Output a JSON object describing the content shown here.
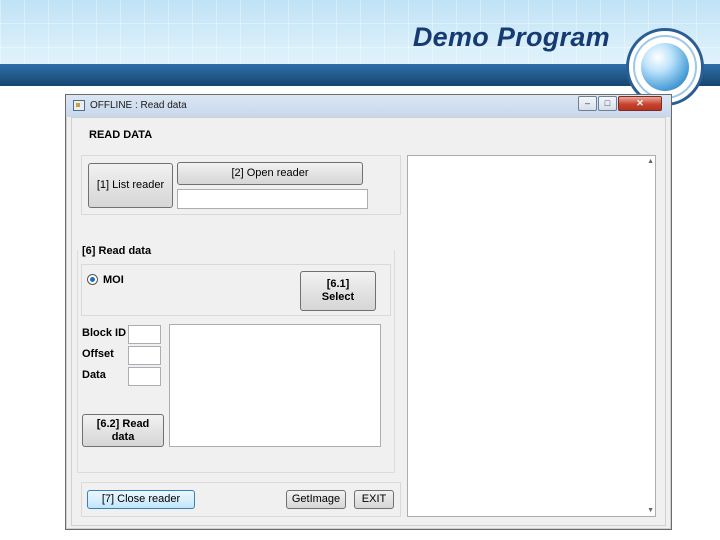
{
  "slide": {
    "title": "Demo Program"
  },
  "window": {
    "title": "OFFLINE : Read data",
    "controls": {
      "minimize": "–",
      "maximize": "□",
      "close": "✕"
    }
  },
  "main": {
    "heading": "READ DATA",
    "reader": {
      "list_label": "[1] List reader",
      "open_label": "[2] Open reader",
      "reader_value": ""
    },
    "read_data": {
      "group_label": "[6] Read data",
      "option_label": "MOI",
      "option_selected": true,
      "select_label_line1": "[6.1]",
      "select_label_line2": "Select",
      "fields": {
        "block_id_label": "Block ID",
        "block_id_value": "",
        "offset_label": "Offset",
        "offset_value": "",
        "data_label": "Data",
        "data_value": ""
      },
      "read_label_line1": "[6.2] Read",
      "read_label_line2": "data",
      "result_value": ""
    },
    "footer": {
      "close_label": "[7] Close reader",
      "getimage_label": "GetImage",
      "exit_label": "EXIT"
    },
    "log_value": ""
  },
  "icons": {
    "app": "app-icon",
    "globe": "globe-icon",
    "radio": "radio-selected-icon"
  },
  "colors": {
    "title_text": "#163b73",
    "banner_band": "#15466f",
    "focus_button": "#bee6fd",
    "close_button": "#c7452f"
  }
}
